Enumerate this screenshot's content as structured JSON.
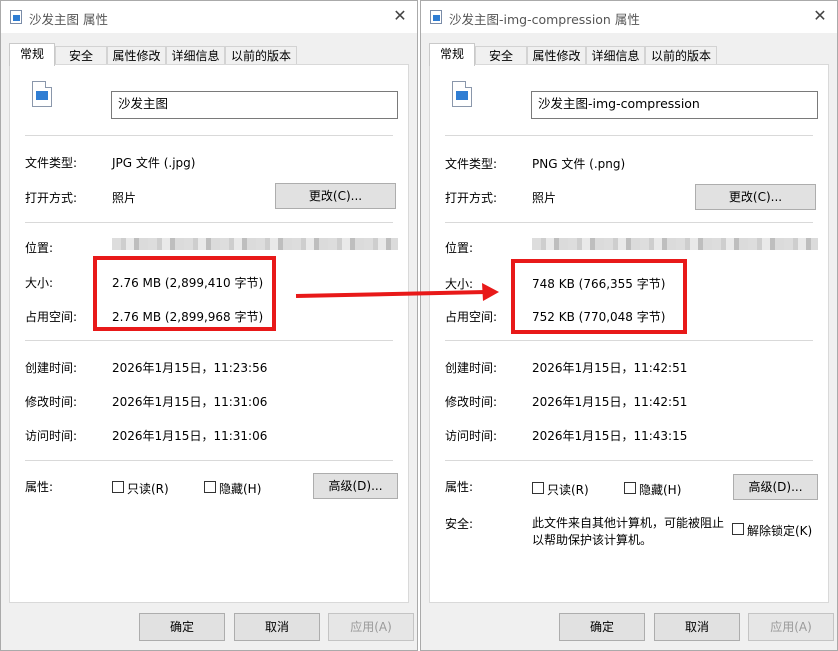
{
  "left": {
    "title": "沙发主图 属性",
    "tabs": [
      "常规",
      "安全",
      "属性修改",
      "详细信息",
      "以前的版本"
    ],
    "file_name": "沙发主图",
    "type_label": "文件类型:",
    "type_value": "JPG 文件 (.jpg)",
    "open_label": "打开方式:",
    "open_value": "照片",
    "change_button": "更改(C)...",
    "location_label": "位置:",
    "size_label": "大小:",
    "size_value": "2.76 MB (2,899,410 字节)",
    "disk_label": "占用空间:",
    "disk_value": "2.76 MB (2,899,968 字节)",
    "created_label": "创建时间:",
    "created_value": "2026年1月15日，11:23:56",
    "modified_label": "修改时间:",
    "modified_value": "2026年1月15日，11:31:06",
    "accessed_label": "访问时间:",
    "accessed_value": "2026年1月15日，11:31:06",
    "attr_label": "属性:",
    "readonly_label": "只读(R)",
    "hidden_label": "隐藏(H)",
    "advanced_button": "高级(D)...",
    "ok_button": "确定",
    "cancel_button": "取消",
    "apply_button": "应用(A)"
  },
  "right": {
    "title": "沙发主图-img-compression 属性",
    "tabs": [
      "常规",
      "安全",
      "属性修改",
      "详细信息",
      "以前的版本"
    ],
    "file_name": "沙发主图-img-compression",
    "type_label": "文件类型:",
    "type_value": "PNG 文件 (.png)",
    "open_label": "打开方式:",
    "open_value": "照片",
    "change_button": "更改(C)...",
    "location_label": "位置:",
    "size_label": "大小:",
    "size_value": "748 KB (766,355 字节)",
    "disk_label": "占用空间:",
    "disk_value": "752 KB (770,048 字节)",
    "created_label": "创建时间:",
    "created_value": "2026年1月15日，11:42:51",
    "modified_label": "修改时间:",
    "modified_value": "2026年1月15日，11:42:51",
    "accessed_label": "访问时间:",
    "accessed_value": "2026年1月15日，11:43:15",
    "attr_label": "属性:",
    "readonly_label": "只读(R)",
    "hidden_label": "隐藏(H)",
    "advanced_button": "高级(D)...",
    "security_label": "安全:",
    "security_text": "此文件来自其他计算机，可能被阻止以帮助保护该计算机。",
    "unblock_label": "解除锁定(K)",
    "ok_button": "确定",
    "cancel_button": "取消",
    "apply_button": "应用(A)"
  },
  "colors": {
    "highlight": "#e81919",
    "dialog_bg": "#f0f0f0",
    "panel_bg": "#ffffff",
    "button_bg": "#e1e1e1"
  },
  "icons": {
    "title": "image-file-icon",
    "close": "close-icon",
    "file": "image-file-icon"
  }
}
